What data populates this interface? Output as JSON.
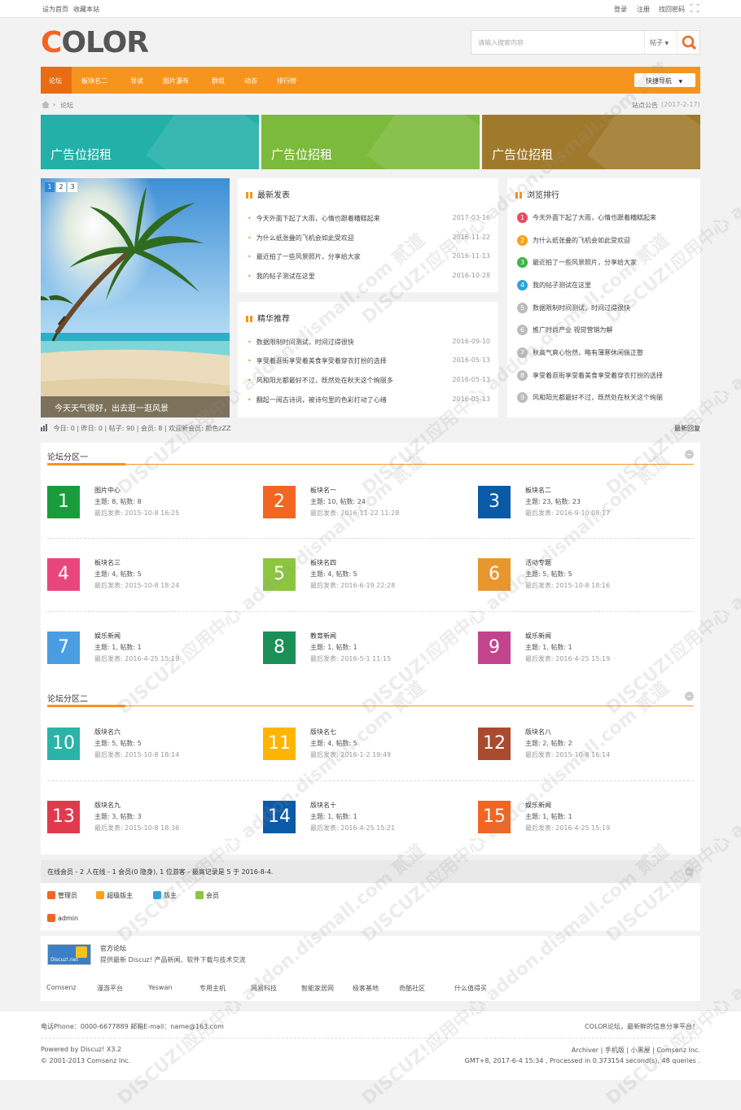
{
  "topbar": {
    "set_home": "设为首页",
    "bookmark": "收藏本站",
    "login": "登录",
    "register": "注册",
    "find_password": "找回密码"
  },
  "logo": {
    "part1": "C",
    "part2": "OLOR"
  },
  "search": {
    "placeholder": "请输入搜索内容",
    "type": "帖子"
  },
  "nav": {
    "items": [
      "论坛",
      "板块名二",
      "导读",
      "图片瀑布",
      "群组",
      "动态",
      "排行榜"
    ],
    "quick": "快捷导航"
  },
  "breadcrumb": {
    "current": "论坛",
    "notice_label": "站点公告",
    "notice_date": "(2017-2-17)"
  },
  "ads": [
    "广告位招租",
    "广告位招租",
    "广告位招租"
  ],
  "slider": {
    "pages": [
      "1",
      "2",
      "3"
    ],
    "caption": "今天天气很好，出去逛一逛风景"
  },
  "latest": {
    "title": "最新发表",
    "items": [
      {
        "text": "今天外面下起了大雨，心情也跟着糟糕起来",
        "date": "2017-03-16"
      },
      {
        "text": "为什么纸张叠的飞机会如此受欢迎",
        "date": "2016-11-22"
      },
      {
        "text": "最近拍了一些风景照片，分享给大家",
        "date": "2016-11-13"
      },
      {
        "text": "我的帖子测试在这里",
        "date": "2016-10-28"
      }
    ]
  },
  "featured": {
    "title": "精华推荐",
    "items": [
      {
        "text": "数据限制时间测试，时间过得很快",
        "date": "2016-09-10"
      },
      {
        "text": "享受着逛街享受着美食享受着穿衣打扮的选择",
        "date": "2016-05-13"
      },
      {
        "text": "风和阳光都最好不过，既然处在秋天这个绚丽多",
        "date": "2016-05-13"
      },
      {
        "text": "翻起一阅古诗词，被诗句里的色彩打动了心绪",
        "date": "2016-05-13"
      }
    ]
  },
  "ranking": {
    "title": "浏览排行",
    "items": [
      {
        "n": "1",
        "text": "今天外面下起了大雨，心情也跟着糟糕起来",
        "color": "#e84a5f"
      },
      {
        "n": "2",
        "text": "为什么纸张叠的飞机会如此受欢迎",
        "color": "#f7a21b"
      },
      {
        "n": "3",
        "text": "最近拍了一些风景照片，分享给大家",
        "color": "#3ab54a"
      },
      {
        "n": "4",
        "text": "我的帖子测试在这里",
        "color": "#2ea3dc"
      },
      {
        "n": "5",
        "text": "数据限制时间测试，时间过得很快",
        "color": "#bbbbbb"
      },
      {
        "n": "6",
        "text": "推广时尚产业 视觉营销为解",
        "color": "#bbbbbb"
      },
      {
        "n": "7",
        "text": "秋高气爽心怡然，略有薄寒休闲倘正憨",
        "color": "#bbbbbb"
      },
      {
        "n": "8",
        "text": "享受着逛街享受着美食享受着穿衣打扮的选择",
        "color": "#bbbbbb"
      },
      {
        "n": "9",
        "text": "风和阳光都最好不过，既然处在秋天这个绚丽",
        "color": "#bbbbbb"
      }
    ]
  },
  "stats": {
    "text": "今日: 0  |  昨日: 0  |  帖子: 90  |  会员: 8  |  欢迎新会员: 颜色zZZ",
    "latest_reply": "最新回复"
  },
  "section1": {
    "title": "论坛分区一",
    "forums": [
      {
        "n": "1",
        "name": "图片中心",
        "count": "主题: 8, 帖数: 8",
        "last": "最后发表: 2015-10-8 16:25",
        "color": "#1a9c3c"
      },
      {
        "n": "2",
        "name": "板块名一",
        "count": "主题: 10, 帖数: 24",
        "last": "最后发表: 2016-11-22 11:28",
        "color": "#f26522"
      },
      {
        "n": "3",
        "name": "板块名二",
        "count": "主题: 23, 帖数: 23",
        "last": "最后发表: 2016-9-10 08:17",
        "color": "#0b5aa8"
      },
      {
        "n": "4",
        "name": "板块名三",
        "count": "主题: 4, 帖数: 5",
        "last": "最后发表: 2015-10-8 18:24",
        "color": "#e8467c"
      },
      {
        "n": "5",
        "name": "板块名四",
        "count": "主题: 4, 帖数: 5",
        "last": "最后发表: 2016-6-19 22:28",
        "color": "#8cc63f"
      },
      {
        "n": "6",
        "name": "活动专题",
        "count": "主题: 5, 帖数: 5",
        "last": "最后发表: 2015-10-8 18:16",
        "color": "#e8962e"
      },
      {
        "n": "7",
        "name": "娱乐新闻",
        "count": "主题: 1, 帖数: 1",
        "last": "最后发表: 2016-4-25 15:19",
        "color": "#4a9de0"
      },
      {
        "n": "8",
        "name": "教育新闻",
        "count": "主题: 1, 帖数: 1",
        "last": "最后发表: 2016-5-1 11:15",
        "color": "#1b8f55"
      },
      {
        "n": "9",
        "name": "娱乐新闻",
        "count": "主题: 1, 帖数: 1",
        "last": "最后发表: 2016-4-25 15:19",
        "color": "#c2448f"
      }
    ]
  },
  "section2": {
    "title": "论坛分区二",
    "forums": [
      {
        "n": "10",
        "name": "版块名六",
        "count": "主题: 5, 帖数: 5",
        "last": "最后发表: 2015-10-8 18:14",
        "color": "#2bb3a6"
      },
      {
        "n": "11",
        "name": "版块名七",
        "count": "主题: 4, 帖数: 5",
        "last": "最后发表: 2016-1-2 19:49",
        "color": "#ffb400"
      },
      {
        "n": "12",
        "name": "版块名八",
        "count": "主题: 2, 帖数: 2",
        "last": "最后发表: 2015-10-8 16:14",
        "color": "#a84b2e"
      },
      {
        "n": "13",
        "name": "版块名九",
        "count": "主题: 3, 帖数: 3",
        "last": "最后发表: 2015-10-8 18:36",
        "color": "#e03a4e"
      },
      {
        "n": "14",
        "name": "版块名十",
        "count": "主题: 1, 帖数: 1",
        "last": "最后发表: 2016-4-25 15:21",
        "color": "#0b5aa8"
      },
      {
        "n": "15",
        "name": "娱乐新闻",
        "count": "主题: 1, 帖数: 1",
        "last": "最后发表: 2016-4-25 15:19",
        "color": "#f26522"
      }
    ]
  },
  "online": {
    "text": "在线会员 - 2 人在线 - 1 会员(0 隐身), 1 位游客 - 最高记录是 5 于 2016-8-4.",
    "legend": [
      "管理员",
      "超级版主",
      "版主",
      "会员"
    ],
    "user": "admin"
  },
  "official": {
    "logo": "Discuz!.net",
    "title": "官方论坛",
    "desc": "提供最新 Discuz! 产品新闻、软件下载与技术交流"
  },
  "friend_links": [
    "Comsenz",
    "漫游平台",
    "Yeswan",
    "专用主机",
    "网易科技",
    "智能家居网",
    "极客基地",
    "奇酷社区",
    "什么值得买"
  ],
  "footer": {
    "contact": "电话Phone：0000-6677889      邮箱E-mail：name@163.com",
    "slogan": "COLOR论坛，最新鲜的信息分享平台！",
    "powered": "Powered by Discuz! X3.2",
    "copyright": "© 2001-2013 Comsenz Inc.",
    "links": "Archiver | 手机版 | 小黑屋 | Comsenz Inc.",
    "time": "GMT+8, 2017-6-4 15:34 , Processed in 0.373154 second(s), 48 queries ."
  },
  "colors": {
    "accent": "#f7941d",
    "nav_active": "#e96c13",
    "ad1": "#22b0a8",
    "ad2": "#7cba3b",
    "ad3": "#a07a2c"
  },
  "watermark": "DISCUZ!应用中心 addon.dismall.com 贰道"
}
